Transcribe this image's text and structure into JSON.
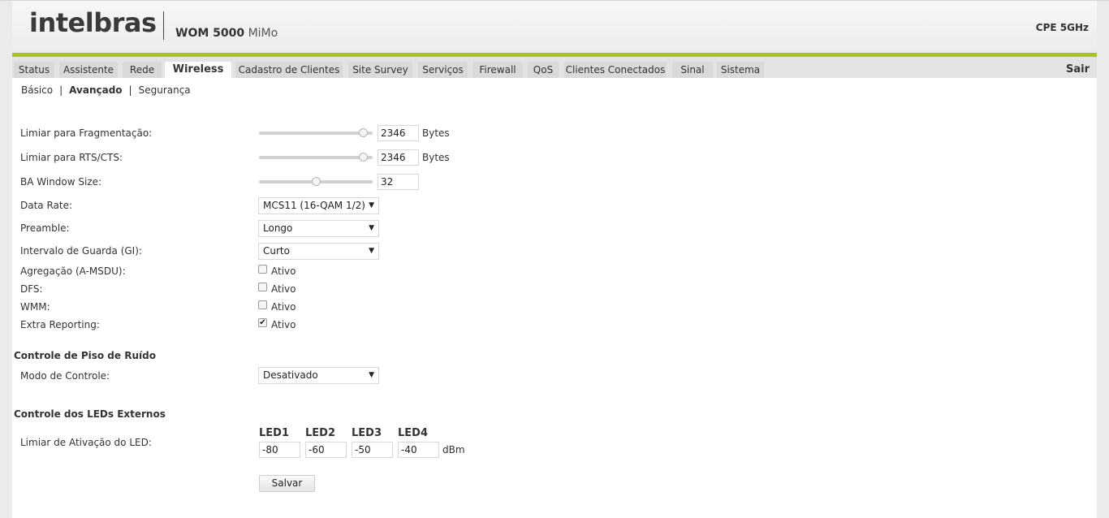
{
  "header": {
    "logo": "intelbras",
    "model_bold": "WOM 5000",
    "model_suffix": "MiMo",
    "device": "CPE 5GHz"
  },
  "nav": {
    "tabs": [
      "Status",
      "Assistente",
      "Rede",
      "Wireless",
      "Cadastro de Clientes",
      "Site Survey",
      "Serviços",
      "Firewall",
      "QoS",
      "Clientes Conectados",
      "Sinal",
      "Sistema"
    ],
    "active": "Wireless",
    "logout": "Sair"
  },
  "subnav": {
    "items": [
      "Básico",
      "Avançado",
      "Segurança"
    ],
    "active": "Avançado",
    "separator": "|"
  },
  "form": {
    "fragmentation": {
      "label": "Limiar para Fragmentação:",
      "value": "2346",
      "unit": "Bytes",
      "slider_fraction": 0.95
    },
    "rts_cts": {
      "label": "Limiar para RTS/CTS:",
      "value": "2346",
      "unit": "Bytes",
      "slider_fraction": 0.95
    },
    "ba_window": {
      "label": "BA Window Size:",
      "value": "32",
      "slider_fraction": 0.5
    },
    "data_rate": {
      "label": "Data Rate:",
      "value": "MCS11 (16-QAM 1/2)"
    },
    "preamble": {
      "label": "Preamble:",
      "value": "Longo"
    },
    "guard_interval": {
      "label": "Intervalo de Guarda (GI):",
      "value": "Curto"
    },
    "aggregation": {
      "label": "Agregação (A-MSDU):",
      "option": "Ativo",
      "checked": false
    },
    "dfs": {
      "label": "DFS:",
      "option": "Ativo",
      "checked": false
    },
    "wmm": {
      "label": "WMM:",
      "option": "Ativo",
      "checked": false
    },
    "extra_reporting": {
      "label": "Extra Reporting:",
      "option": "Ativo",
      "checked": true
    }
  },
  "noise_floor": {
    "title": "Controle de Piso de Ruído",
    "mode_label": "Modo de Controle:",
    "mode_value": "Desativado"
  },
  "leds": {
    "title": "Controle dos LEDs Externos",
    "threshold_label": "Limiar de Ativação do LED:",
    "headers": [
      "LED1",
      "LED2",
      "LED3",
      "LED4"
    ],
    "values": [
      "-80",
      "-60",
      "-50",
      "-40"
    ],
    "unit": "dBm"
  },
  "save_label": "Salvar"
}
